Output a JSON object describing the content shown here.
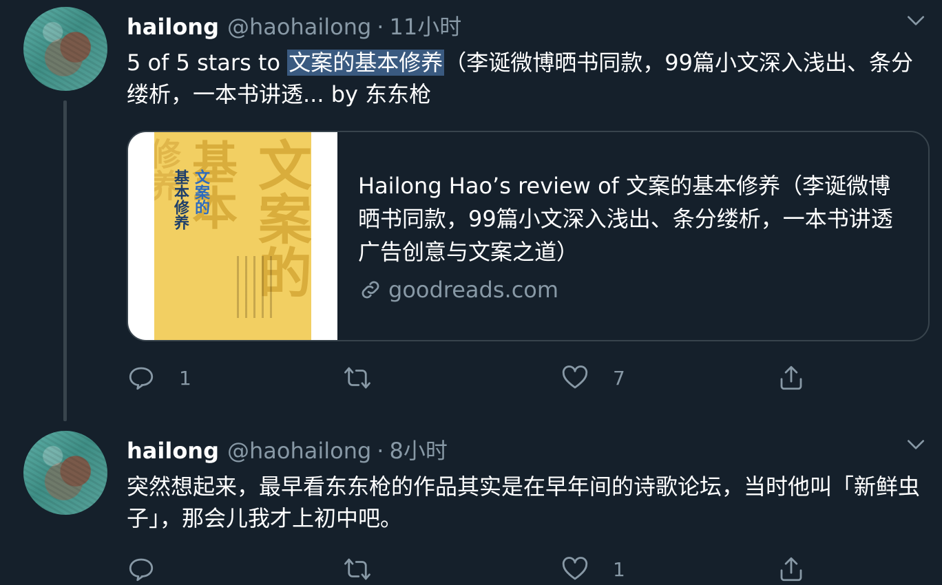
{
  "tweets": [
    {
      "name": "hailong",
      "handle": "@haohailong",
      "separator": "·",
      "time": "11小时",
      "text_prefix": "5 of 5 stars to ",
      "text_highlight": "文案的基本修养",
      "text_suffix": "（李诞微博晒书同款，99篇小文深入浅出、条分缕析，一本书讲透... by 东东枪",
      "card": {
        "title": "Hailong Hao’s review of 文案的基本修养（李诞微博晒书同款，99篇小文深入浅出、条分缕析，一本书讲透广告创意与文案之道）",
        "domain": "goodreads.com",
        "cover_text": {
          "big_1": "文案的",
          "big_2": "基本",
          "big_3": "修养",
          "small_title_a": "文案的",
          "small_title_b": "基本修养"
        }
      },
      "replies": "1",
      "retweets": "",
      "likes": "7"
    },
    {
      "name": "hailong",
      "handle": "@haohailong",
      "separator": "·",
      "time": "8小时",
      "text": "突然想起来，最早看东东枪的作品其实是在早年间的诗歌论坛，当时他叫「新鲜虫子」，那会儿我才上初中吧。",
      "replies": "",
      "retweets": "",
      "likes": "1"
    }
  ],
  "colors": {
    "background": "#15202b",
    "text": "#ffffff",
    "muted": "#8899a6",
    "border": "#38444d",
    "highlight": "#3a5a80",
    "cover": "#f2cf62"
  },
  "icons": [
    "chevron-down-icon",
    "reply-icon",
    "retweet-icon",
    "like-icon",
    "share-icon",
    "link-icon"
  ]
}
